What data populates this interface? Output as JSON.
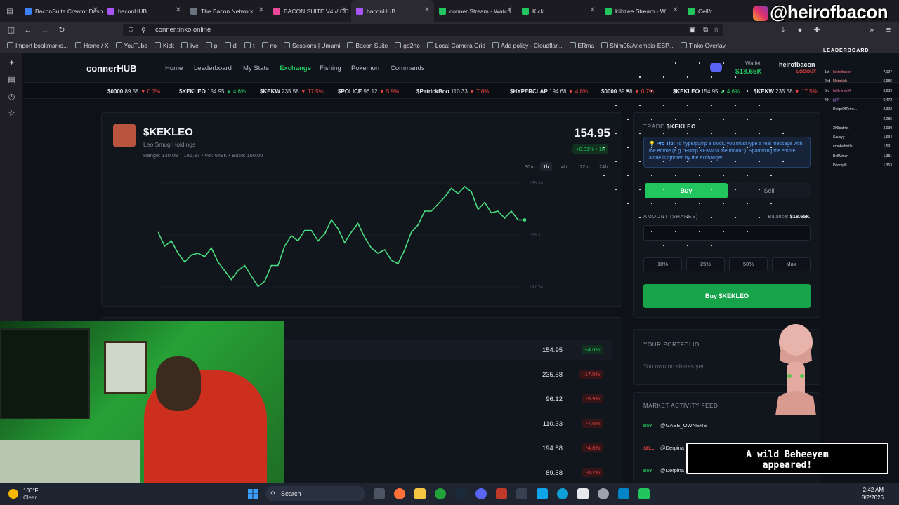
{
  "browser": {
    "tabs": [
      {
        "label": "BaconSuite Creator Dashbo",
        "color": "#3b82f6"
      },
      {
        "label": "baconHUB",
        "color": "#a855f7"
      },
      {
        "label": "The Bacon Network",
        "color": "#6b7280"
      },
      {
        "label": "BACON SUITE V4 // CO",
        "color": "#ec4899"
      },
      {
        "label": "baconHUB",
        "color": "#a855f7",
        "active": true
      },
      {
        "label": "conner Stream - Watch",
        "color": "#22c55e"
      },
      {
        "label": "Kick",
        "color": "#22c55e"
      },
      {
        "label": "kiibzee Stream - W",
        "color": "#22c55e"
      },
      {
        "label": "Cellfr",
        "color": "#22c55e"
      }
    ],
    "url": "conner.tinko.online",
    "bookmarks": [
      "Import bookmarks...",
      "Home / X",
      "YouTube",
      "Kick",
      "live",
      "p",
      "dl",
      "t",
      "no",
      "Sessions | Umami",
      "Bacon Suite",
      "go2rtc",
      "Local Camera Grid",
      "Add policy - Cloudflar...",
      "ERma",
      "Shim06/Anemoia-ESP...",
      "Tinko Overlay"
    ]
  },
  "site": {
    "brand": "connerHUB",
    "nav": [
      "Home",
      "Leaderboard",
      "My Stats",
      "Exchange",
      "Fishing",
      "Pokemon",
      "Commands"
    ],
    "active_nav": "Exchange",
    "wallet_label": "Wallet",
    "wallet_value": "$18.65K",
    "username": "heirofbacon",
    "logout": "LOGOUT"
  },
  "ticker": [
    {
      "sym": "$0000",
      "price": "89.58",
      "chg": "▼ 0.7%",
      "dir": "dn"
    },
    {
      "sym": "$KEKLEO",
      "price": "154.95",
      "chg": "▲ 4.6%",
      "dir": "up"
    },
    {
      "sym": "$KEKW",
      "price": "235.58",
      "chg": "▼ 17.5%",
      "dir": "dn"
    },
    {
      "sym": "$POLICE",
      "price": "96.12",
      "chg": "▼ 5.9%",
      "dir": "dn"
    },
    {
      "sym": "$PatrickBoo",
      "price": "110.33",
      "chg": "▼ 7.6%",
      "dir": "dn"
    },
    {
      "sym": "$HYPERCLAP",
      "price": "194.68",
      "chg": "▼ 4.8%",
      "dir": "dn"
    },
    {
      "sym": "$0000",
      "price": "89.58",
      "chg": "▼ 0.7%",
      "dir": "dn"
    },
    {
      "sym": "$KEKLEO",
      "price": "154.95",
      "chg": "▲ 4.6%",
      "dir": "up"
    },
    {
      "sym": "$KEKW",
      "price": "235.58",
      "chg": "▼ 17.5%",
      "dir": "dn"
    }
  ],
  "stock": {
    "symbol": "$KEKLEO",
    "company": "Leo Smug Holdings",
    "stats": "Range: 130.09 – 165.37  •  Vol: 649K  •  Base: 150.00",
    "price": "154.95",
    "change": "+0.31% • 1h",
    "timeframes": [
      "30m",
      "1h",
      "4h",
      "12h",
      "24h"
    ],
    "active_tf": "1h",
    "y_labels": [
      "155.30",
      "153.31",
      "147.24"
    ]
  },
  "chart_data": {
    "type": "line",
    "y": [
      158,
      150,
      153,
      146,
      141,
      145,
      146,
      144,
      149,
      141,
      136,
      131,
      136,
      139,
      133,
      127,
      130,
      139,
      139,
      150,
      156,
      153,
      159,
      159,
      153,
      157,
      165,
      160,
      152,
      158,
      163,
      155,
      149,
      146,
      148,
      142,
      140,
      148,
      158,
      162,
      170,
      170,
      174,
      178,
      183,
      180,
      184,
      181,
      171,
      175,
      169,
      170,
      166,
      170,
      165,
      165
    ]
  },
  "trade": {
    "title_prefix": "TRADE",
    "symbol": "$KEKLEO",
    "tip_bold": "Pro Tip:",
    "tip": "To hype/pump a stock, you must type a real message with the emote (e.g. \"Pump KEKW to the moon!\"). Spamming the emote alone is ignored by the exchange!",
    "buy_tab": "Buy",
    "sell_tab": "Sell",
    "amount_label": "AMOUNT (SHARES)",
    "balance_label": "Balance:",
    "balance_value": "$18.65K",
    "pct_buttons": [
      "10%",
      "25%",
      "50%",
      "Max"
    ],
    "buy_button": "Buy $KEKLEO"
  },
  "stock_list": [
    {
      "price": "154.95",
      "chg": "+4.6%",
      "dir": "up"
    },
    {
      "price": "235.58",
      "chg": "-17.5%",
      "dir": "dn"
    },
    {
      "price": "96.12",
      "chg": "-5.9%",
      "dir": "dn"
    },
    {
      "price": "110.33",
      "chg": "-7.6%",
      "dir": "dn"
    },
    {
      "price": "194.68",
      "chg": "-4.8%",
      "dir": "dn"
    },
    {
      "price": "89.58",
      "chg": "-0.7%",
      "dir": "dn"
    }
  ],
  "portfolio": {
    "title": "YOUR PORTFOLIO",
    "empty": "You own no shares yet."
  },
  "feed": {
    "title": "MARKET ACTIVITY FEED",
    "items": [
      {
        "tag": "BUY",
        "user": "@GABE_OWNERS"
      },
      {
        "tag": "SELL",
        "user": "@Derpina"
      },
      {
        "tag": "BUY",
        "user": "@Derpina"
      }
    ]
  },
  "overlay": {
    "handle": "@heirofbacon",
    "leaderboard_title": "LEADERBOARD",
    "leaderboard": [
      {
        "rank": "1st",
        "name": "heirofbacon",
        "score": "7,197"
      },
      {
        "rank": "2nd",
        "name": "Metaltich",
        "score": "6,986"
      },
      {
        "rank": "3rd",
        "name": "bellminer94",
        "score": "6,639"
      },
      {
        "rank": "4th",
        "name": "pjt7",
        "score": "6,472"
      },
      {
        "rank": "",
        "name": "ReignOfTerro...",
        "score": "2,392"
      },
      {
        "rank": "",
        "name": "",
        "score": "2,286"
      },
      {
        "rank": "",
        "name": "209patriot",
        "score": "2,030"
      },
      {
        "rank": "",
        "name": "Saucyy",
        "score": "1,634"
      },
      {
        "rank": "",
        "name": "crookwhistle",
        "score": "1,591"
      },
      {
        "rank": "",
        "name": "BellMiner",
        "score": "1,381"
      },
      {
        "rank": "",
        "name": "Doompill",
        "score": "1,353"
      }
    ],
    "wild_line1": "A wild Beheeyem",
    "wild_line2": "appeared!"
  },
  "taskbar": {
    "temp": "100°F",
    "weather": "Clear",
    "search": "Search",
    "time": "2:42 AM",
    "date": "8/2/2026"
  },
  "colors": {
    "accent": "#22c55e",
    "down": "#ef4444",
    "tip": "#60a5fa"
  }
}
